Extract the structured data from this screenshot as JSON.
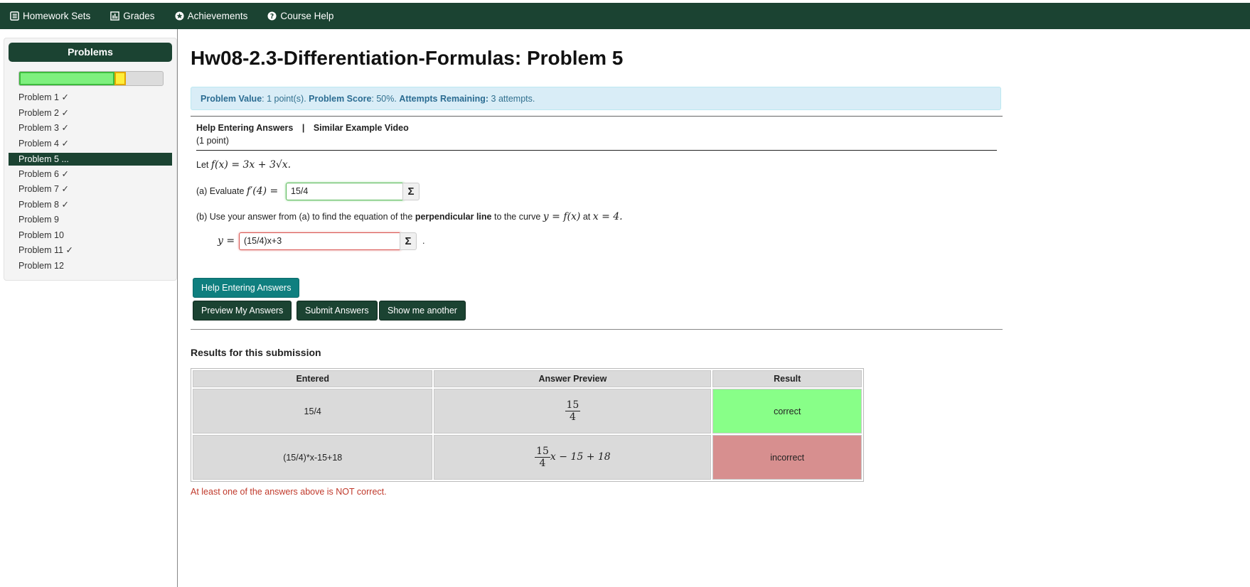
{
  "nav": {
    "homework_sets": "Homework Sets",
    "grades": "Grades",
    "achievements": "Achievements",
    "course_help": "Course Help"
  },
  "sidebar": {
    "title": "Problems",
    "progress": {
      "correct_fraction": 0.665,
      "partial_fraction": 0.08
    },
    "items": [
      {
        "label": "Problem 1 ✓"
      },
      {
        "label": "Problem 2 ✓"
      },
      {
        "label": "Problem 3 ✓"
      },
      {
        "label": "Problem 4 ✓"
      },
      {
        "label": "Problem 5 ...",
        "active": true
      },
      {
        "label": "Problem 6 ✓"
      },
      {
        "label": "Problem 7 ✓"
      },
      {
        "label": "Problem 8 ✓"
      },
      {
        "label": "Problem 9"
      },
      {
        "label": "Problem 10"
      },
      {
        "label": "Problem 11 ✓"
      },
      {
        "label": "Problem 12"
      }
    ]
  },
  "main": {
    "title": "Hw08-2.3-Differentiation-Formulas: Problem 5",
    "info": {
      "value_label": "Problem Value",
      "value_text": ": 1 point(s).",
      "score_label": "Problem Score",
      "score_text": ": 50%.",
      "attempts_label": "Attempts Remaining:",
      "attempts_text": "3 attempts."
    },
    "problem": {
      "help_link": "Help Entering Answers",
      "separator": "|",
      "video_link": "Similar Example Video",
      "points": "(1 point)",
      "let_text": "Let",
      "function_text": "f(x) = 3x + 3√x.",
      "part_a_text": "(a) Evaluate",
      "part_a_math": "f′(4) =",
      "answer_a": "15/4",
      "part_b_pre": "(b) Use your answer from (a) to find the equation of the",
      "part_b_bold": "perpendicular line",
      "part_b_post": "to the curve",
      "part_b_math1": "y = f(x)",
      "part_b_at": "at",
      "part_b_math2": "x = 4.",
      "y_label": "y =",
      "answer_b": "(15/4)x+3",
      "answer_b_suffix": ".",
      "sigma": "Σ"
    },
    "buttons": {
      "help": "Help Entering Answers",
      "preview": "Preview My Answers",
      "submit": "Submit Answers",
      "another": "Show me another"
    },
    "results": {
      "title": "Results for this submission",
      "headers": [
        "Entered",
        "Answer Preview",
        "Result"
      ],
      "rows": [
        {
          "entered": "15/4",
          "preview_num": "15",
          "preview_den": "4",
          "preview_rest": "",
          "result": "correct"
        },
        {
          "entered": "(15/4)*x-15+18",
          "preview_num": "15",
          "preview_den": "4",
          "preview_rest": "x − 15 + 18",
          "result": "incorrect"
        }
      ],
      "warning": "At least one of the answers above is NOT correct."
    }
  },
  "colors": {
    "nav_bg": "#1b4332",
    "correct": "#88ff88",
    "incorrect": "#d78f8f",
    "teal_button": "#0f7f7f"
  }
}
